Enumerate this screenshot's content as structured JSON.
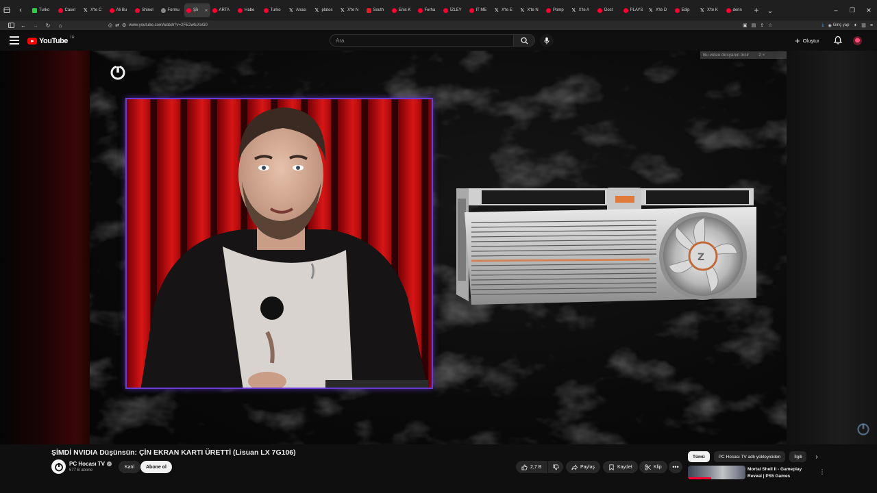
{
  "browser": {
    "tabs": [
      {
        "label": "Turko",
        "favicon": "k-icon"
      },
      {
        "label": "Casel",
        "favicon": "youtube-icon"
      },
      {
        "label": "X'te C",
        "favicon": "x-icon"
      },
      {
        "label": "Ali Bu",
        "favicon": "youtube-icon"
      },
      {
        "label": "Shinol",
        "favicon": "youtube-icon"
      },
      {
        "label": "Formu",
        "favicon": "globe-icon"
      },
      {
        "label": "Şİı",
        "favicon": "youtube-icon",
        "active": true
      },
      {
        "label": "ARTA",
        "favicon": "youtube-icon"
      },
      {
        "label": "Habe",
        "favicon": "youtube-icon"
      },
      {
        "label": "Turko",
        "favicon": "youtube-icon"
      },
      {
        "label": "Anası",
        "favicon": "x-icon"
      },
      {
        "label": "platos",
        "favicon": "x-icon"
      },
      {
        "label": "X'te N",
        "favicon": "x-icon"
      },
      {
        "label": "South",
        "favicon": "c-icon"
      },
      {
        "label": "Enis K",
        "favicon": "youtube-icon"
      },
      {
        "label": "Ferha",
        "favicon": "youtube-icon"
      },
      {
        "label": "İZLEY",
        "favicon": "youtube-icon"
      },
      {
        "label": "IT ME",
        "favicon": "youtube-icon"
      },
      {
        "label": "X'te E",
        "favicon": "x-icon"
      },
      {
        "label": "X'te N",
        "favicon": "x-icon"
      },
      {
        "label": "Pomp",
        "favicon": "youtube-icon"
      },
      {
        "label": "X'te A",
        "favicon": "x-icon"
      },
      {
        "label": "Dost",
        "favicon": "youtube-icon"
      },
      {
        "label": "PLAYS",
        "favicon": "youtube-icon"
      },
      {
        "label": "X'te D",
        "favicon": "x-icon"
      },
      {
        "label": "Edip",
        "favicon": "youtube-icon"
      },
      {
        "label": "X'te K",
        "favicon": "x-icon"
      },
      {
        "label": "derin",
        "favicon": "youtube-icon"
      }
    ],
    "url": "www.youtube.com/watch?v=2FE2wfuXxG0",
    "signin_label": "Giriş yap"
  },
  "youtube": {
    "logo_text": "YouTube",
    "country_code": "TR",
    "search_placeholder": "Ara",
    "create_label": "Oluştur"
  },
  "player": {
    "annotation_text": "Bu video dosyanın incir",
    "annotation_suffix": "2 ×"
  },
  "video": {
    "title": "ŞİMDİ NVIDIA Düşünsün: ÇİN EKRAN KARTI ÜRETTİ (Lisuan LX 7G106)",
    "channel_name": "PC Hocası TV",
    "subscribers": "577 B abone",
    "join_label": "Katıl",
    "subscribe_label": "Abone ol",
    "like_count": "2,7 B",
    "share_label": "Paylaş",
    "save_label": "Kaydet",
    "clip_label": "Klip"
  },
  "recommendations": {
    "chips": [
      {
        "label": "Tümü",
        "selected": true
      },
      {
        "label": "PC Hocası TV adlı yükleyiciden",
        "selected": false
      },
      {
        "label": "İlgili",
        "selected": false
      }
    ],
    "first_item_title": "Mortal Shell II - Gameplay Reveal | PS5 Games"
  },
  "colors": {
    "accent_red": "#ff0033",
    "frame_purple": "#6b3bd8",
    "background": "#0f0f0f"
  }
}
